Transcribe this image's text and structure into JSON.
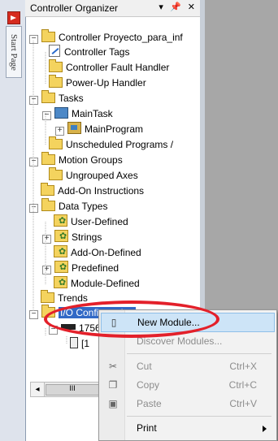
{
  "start_page": {
    "tab_label": "Start Page",
    "icon": "start-page-icon"
  },
  "organizer": {
    "title": "Controller Organizer",
    "title_buttons": [
      "▾",
      "ᵖ",
      "✕"
    ]
  },
  "tree": [
    {
      "label": "Controller Proyecto_para_inf",
      "icon": "folder-icon"
    },
    {
      "label": "Controller Tags",
      "icon": "tags-icon"
    },
    {
      "label": "Controller Fault Handler",
      "icon": "folder-icon"
    },
    {
      "label": "Power-Up Handler",
      "icon": "folder-icon"
    },
    {
      "label": "Tasks",
      "icon": "folder-icon"
    },
    {
      "label": "MainTask",
      "icon": "task-icon"
    },
    {
      "label": "MainProgram",
      "icon": "program-icon"
    },
    {
      "label": "Unscheduled Programs /",
      "icon": "folder-icon"
    },
    {
      "label": "Motion Groups",
      "icon": "folder-icon"
    },
    {
      "label": "Ungrouped Axes",
      "icon": "folder-icon"
    },
    {
      "label": "Add-On Instructions",
      "icon": "folder-icon"
    },
    {
      "label": "Data Types",
      "icon": "folder-icon"
    },
    {
      "label": "User-Defined",
      "icon": "datatype-icon"
    },
    {
      "label": "Strings",
      "icon": "datatype-icon"
    },
    {
      "label": "Add-On-Defined",
      "icon": "datatype-icon"
    },
    {
      "label": "Predefined",
      "icon": "datatype-icon"
    },
    {
      "label": "Module-Defined",
      "icon": "datatype-icon"
    },
    {
      "label": "Trends",
      "icon": "folder-icon"
    },
    {
      "label": "I/O Configuration",
      "icon": "folder-icon"
    },
    {
      "label": "1756",
      "icon": "chassis-icon"
    },
    {
      "label": "[1",
      "icon": "module-icon"
    }
  ],
  "scrollbar": {
    "thumb_glyph": "III",
    "left_arrow": "◂"
  },
  "context_menu": {
    "items": [
      {
        "label": "New Module...",
        "shortcut": "",
        "enabled": true,
        "highlight": true,
        "icon": "new-module-icon"
      },
      {
        "label": "Discover Modules...",
        "shortcut": "",
        "enabled": false,
        "icon": ""
      },
      {
        "label": "Cut",
        "shortcut": "Ctrl+X",
        "enabled": false,
        "icon": "cut-icon"
      },
      {
        "label": "Copy",
        "shortcut": "Ctrl+C",
        "enabled": false,
        "icon": "copy-icon"
      },
      {
        "label": "Paste",
        "shortcut": "Ctrl+V",
        "enabled": false,
        "icon": "paste-icon"
      },
      {
        "label": "Print",
        "shortcut": "",
        "enabled": true,
        "submenu": true,
        "icon": ""
      }
    ]
  },
  "annotation": {
    "color": "#e3202a",
    "shape": "ellipse"
  }
}
